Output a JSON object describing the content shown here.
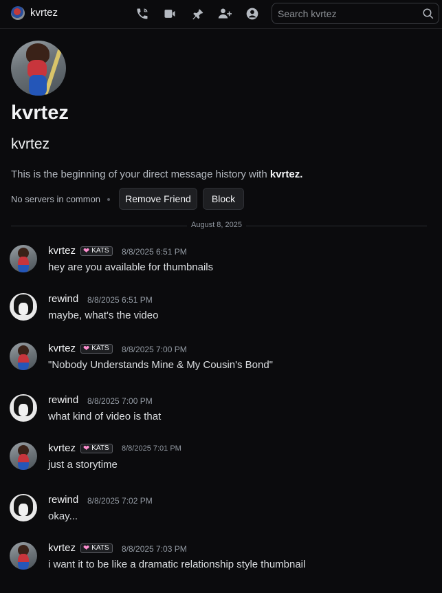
{
  "header": {
    "title": "kvrtez",
    "icons": [
      "voice-call-icon",
      "video-call-icon",
      "pin-icon",
      "add-friend-icon",
      "profile-icon"
    ],
    "search_placeholder": "Search kvrtez"
  },
  "profile": {
    "display_name": "kvrtez",
    "username": "kvrtez",
    "intro_prefix": "This is the beginning of your direct message history with ",
    "intro_name": "kvrtez.",
    "servers_text": "No servers in common",
    "remove_friend_label": "Remove Friend",
    "block_label": "Block"
  },
  "date_divider": "August 8, 2025",
  "messages": [
    {
      "author": "kvrtez",
      "badge": "KATS",
      "time": "8/8/2025 6:51 PM",
      "text": "hey are you available for thumbnails"
    },
    {
      "author": "rewind",
      "badge": "",
      "time": "8/8/2025 6:51 PM",
      "text": "maybe, what's the video"
    },
    {
      "author": "kvrtez",
      "badge": "KATS",
      "time": "8/8/2025 7:00 PM",
      "text": "\"Nobody Understands Mine & My Cousin's Bond\""
    },
    {
      "author": "rewind",
      "badge": "",
      "time": "8/8/2025 7:00 PM",
      "text": "what kind of video is that"
    },
    {
      "author": "kvrtez",
      "badge": "KATS",
      "time": "8/8/2025 7:01 PM",
      "text": "just a storytime"
    },
    {
      "author": "rewind",
      "badge": "",
      "time": "8/8/2025 7:02 PM",
      "text": "okay..."
    },
    {
      "author": "kvrtez",
      "badge": "KATS",
      "time": "8/8/2025 7:03 PM",
      "text": "i want it to be like a dramatic relationship style thumbnail"
    }
  ],
  "colors": {
    "background": "#0b0b0d",
    "text_primary": "#f2f3f5",
    "text_muted": "#949ba4",
    "badge_heart": "#ff8fd0"
  }
}
